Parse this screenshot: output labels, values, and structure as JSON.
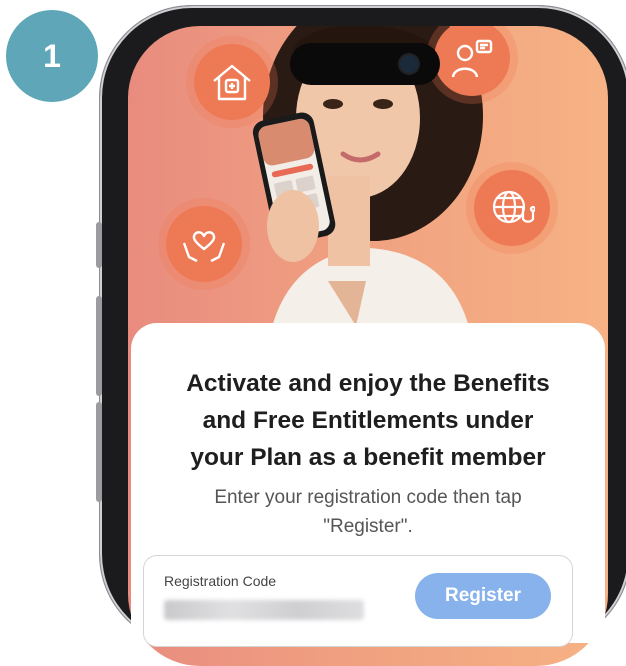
{
  "step": {
    "number": "1"
  },
  "card": {
    "title_lines": [
      "Activate and enjoy the Benefits",
      "and Free Entitlements under",
      "your Plan as a benefit member"
    ],
    "subtitle_lines": [
      "Enter your registration code then tap",
      "\"Register\"."
    ]
  },
  "form": {
    "field_label": "Registration Code",
    "register_label": "Register"
  },
  "icons": [
    "home-care-icon",
    "doctor-chat-icon",
    "heart-hands-icon",
    "global-health-icon"
  ],
  "colors": {
    "badge": "#5fa7b8",
    "icon_circle": "#ee7a55",
    "button": "#88b2ec"
  }
}
